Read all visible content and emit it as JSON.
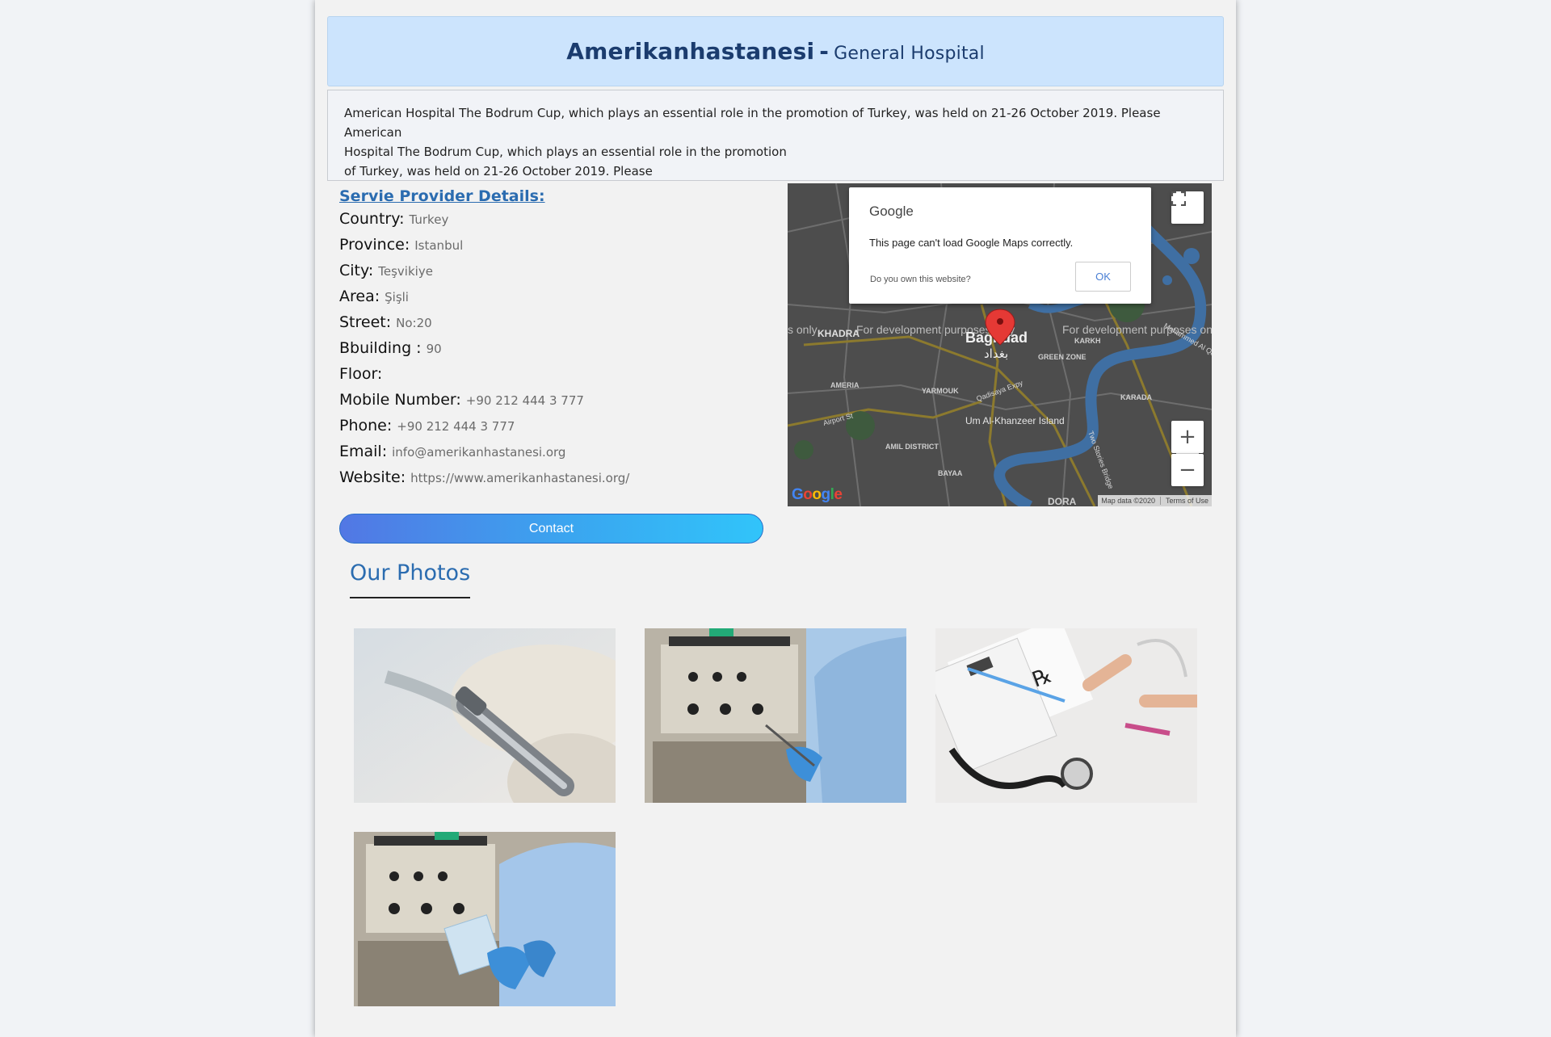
{
  "header": {
    "name": "Amerikanhastanesi",
    "separator": "-",
    "category": "General Hospital"
  },
  "description": "American Hospital The Bodrum Cup, which plays an essential role in the promotion of Turkey, was held on 21-26 October 2019. Please American\nHospital The Bodrum Cup, which plays an essential role in the promotion\nof Turkey, was held on 21-26 October 2019. Please",
  "details": {
    "title": "Servie Provider Details:",
    "rows": [
      {
        "label": "Country:",
        "value": "Turkey"
      },
      {
        "label": "Province:",
        "value": "Istanbul"
      },
      {
        "label": "City:",
        "value": "Teşvikiye"
      },
      {
        "label": "Area:",
        "value": "Şişli"
      },
      {
        "label": "Street:",
        "value": "No:20"
      },
      {
        "label": "Bbuilding :",
        "value": "90"
      },
      {
        "label": "Floor:",
        "value": ""
      },
      {
        "label": "Mobile Number:",
        "value": "+90 212 444 3 777"
      },
      {
        "label": "Phone:",
        "value": "+90 212 444 3 777"
      },
      {
        "label": "Email:",
        "value": "info@amerikanhastanesi.org"
      },
      {
        "label": "Website:",
        "value": "https://www.amerikanhastanesi.org/"
      }
    ]
  },
  "contact_button": "Contact",
  "map": {
    "dialog_brand": "Google",
    "dialog_message": "This page can't load Google Maps correctly.",
    "dialog_question": "Do you own this website?",
    "dialog_ok": "OK",
    "watermark": "For development purposes only",
    "city_label": "Baghdad",
    "city_label_ar": "بغداد",
    "places": [
      "KHADRA",
      "KARKH",
      "GREEN ZONE",
      "AMERIA",
      "YARMOUK",
      "Um Al-Khanzeer Island",
      "KARADA",
      "AMIL DISTRICT",
      "BAYAA",
      "DORA",
      "Qadisaya Expy",
      "Airport St",
      "Two Stories Bridge",
      "Mohammed Al Qasim"
    ],
    "zoom_in": "+",
    "zoom_out": "−",
    "logo": "Google",
    "map_data": "Map data ©2020",
    "terms": "Terms of Use"
  },
  "photos": {
    "title": "Our Photos",
    "items": [
      "dental-handpiece-photo",
      "surgeon-instruments-photo",
      "prescription-stethoscope-photo",
      "surgeon-package-photo"
    ]
  },
  "colors": {
    "header_bg": "#cce4fd",
    "accent": "#2b6cb0",
    "button_gradient_start": "#5277e4",
    "button_gradient_end": "#31c4fa"
  }
}
